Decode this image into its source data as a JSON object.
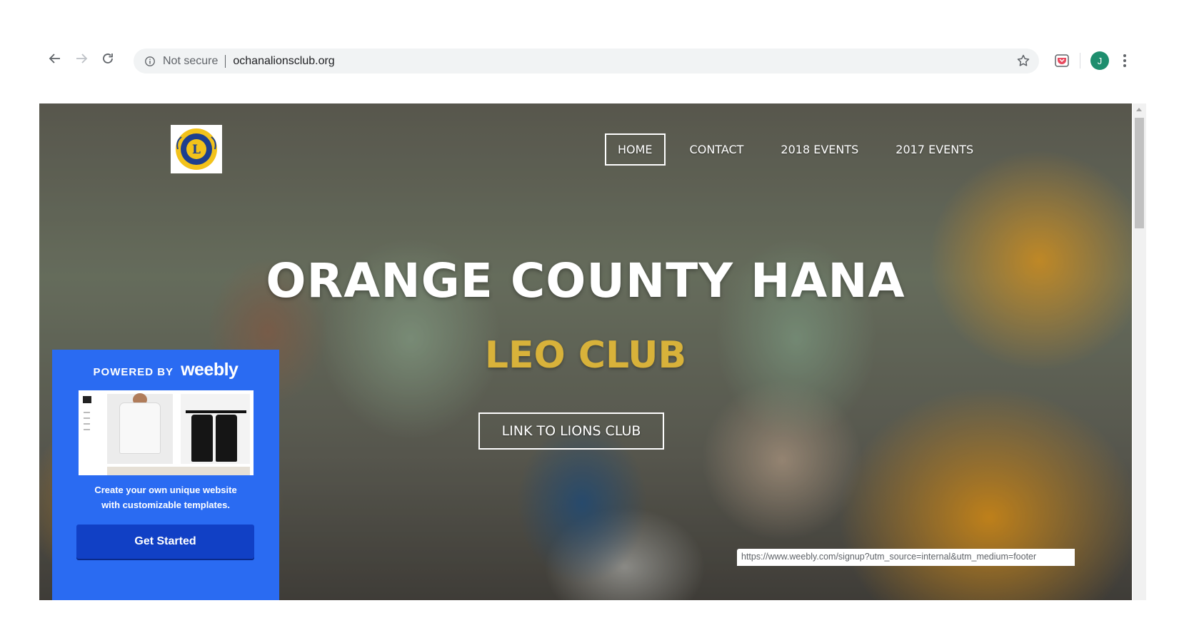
{
  "browser": {
    "security_label": "Not secure",
    "url": "ochanalionsclub.org",
    "avatar_initial": "J",
    "icons": [
      "back-icon",
      "forward-icon",
      "reload-icon",
      "info-icon",
      "star-icon",
      "pocket-extension-icon",
      "profile-avatar",
      "menu-kebab-icon"
    ]
  },
  "site": {
    "logo_alt": "LIONS INTERNATIONAL",
    "nav": [
      {
        "label": "HOME",
        "active": true
      },
      {
        "label": "CONTACT",
        "active": false
      },
      {
        "label": "2018 EVENTS",
        "active": false
      },
      {
        "label": "2017 EVENTS",
        "active": false
      }
    ],
    "hero": {
      "title": "ORANGE COUNTY HANA",
      "subtitle": "LEO CLUB",
      "button": "LINK TO LIONS CLUB"
    },
    "colors": {
      "subtitle": "#d8b23a",
      "weebly_blue": "#2a6bf2",
      "cta_blue": "#1140c5"
    }
  },
  "weebly_promo": {
    "powered_by": "POWERED BY",
    "brand": "weebly",
    "line1": "Create your own unique website",
    "line2": "with customizable templates.",
    "cta": "Get Started"
  },
  "status_bar": {
    "url": "https://www.weebly.com/signup?utm_source=internal&utm_medium=footer"
  }
}
